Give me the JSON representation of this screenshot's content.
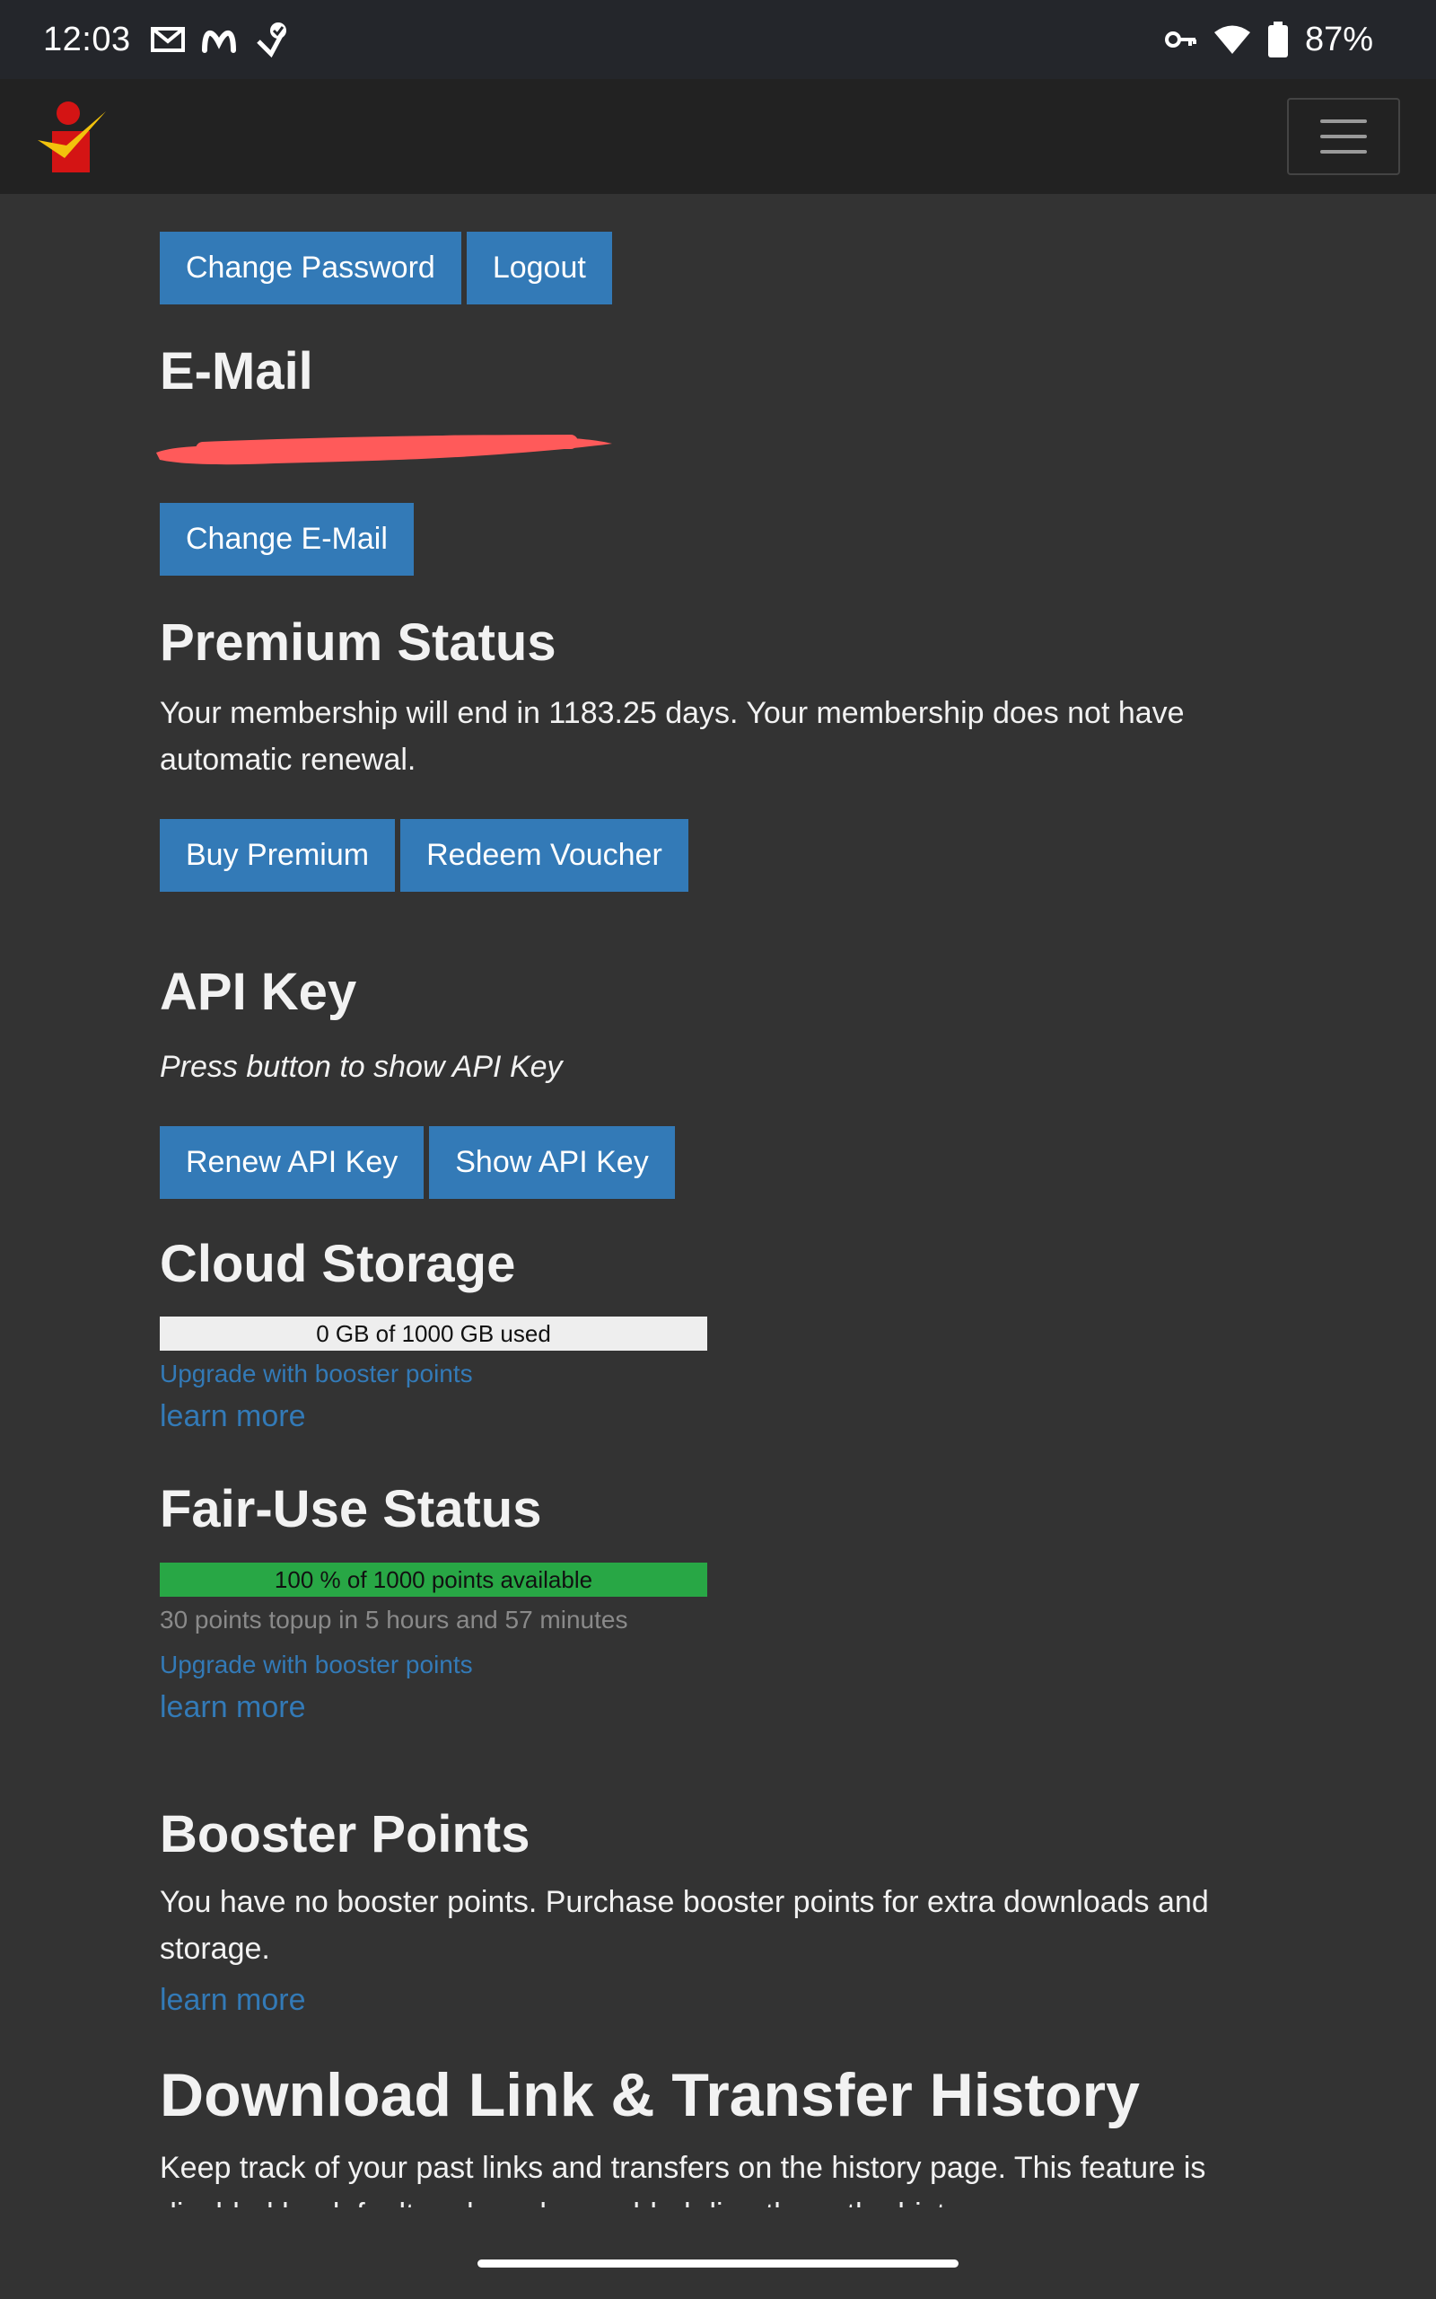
{
  "status_bar": {
    "time": "12:03",
    "battery": "87%",
    "icons": [
      "gmail-icon",
      "m-app-icon",
      "check-shield-icon",
      "vpn-key-icon",
      "wifi-icon",
      "battery-icon"
    ]
  },
  "navbar": {
    "logo": "site-logo",
    "menu_icon": "hamburger-menu-icon"
  },
  "account": {
    "change_password": "Change Password",
    "logout": "Logout"
  },
  "email": {
    "heading": "E-Mail",
    "change_email": "Change E-Mail"
  },
  "premium": {
    "heading": "Premium Status",
    "text": "Your membership will end in 1183.25 days. Your membership does not have automatic renewal.",
    "buy": "Buy Premium",
    "redeem": "Redeem Voucher"
  },
  "api": {
    "heading": "API Key",
    "hint": "Press button to show API Key",
    "renew": "Renew API Key",
    "show": "Show API Key"
  },
  "cloud": {
    "heading": "Cloud Storage",
    "usage_label": "0 GB of 1000 GB used",
    "used_fraction": 0,
    "upgrade": "Upgrade with booster points",
    "learn_more": "learn more"
  },
  "fair_use": {
    "heading": "Fair-Use Status",
    "usage_label": "100 % of 1000 points available",
    "available_fraction": 1.0,
    "topup": "30 points topup in 5 hours and 57 minutes",
    "upgrade": "Upgrade with booster points",
    "learn_more": "learn more"
  },
  "booster": {
    "heading": "Booster Points",
    "text": "You have no booster points. Purchase booster points for extra downloads and storage.",
    "learn_more": "learn more"
  },
  "history": {
    "heading": "Download Link & Transfer History",
    "text": "Keep track of your past links and transfers on the history page. This feature is disabled by default and can be enabled directly on the history page."
  },
  "colors": {
    "primary": "#337ab7",
    "success": "#28a745",
    "background": "#333333",
    "navbar": "#222222",
    "redaction": "#ff5a5a"
  }
}
